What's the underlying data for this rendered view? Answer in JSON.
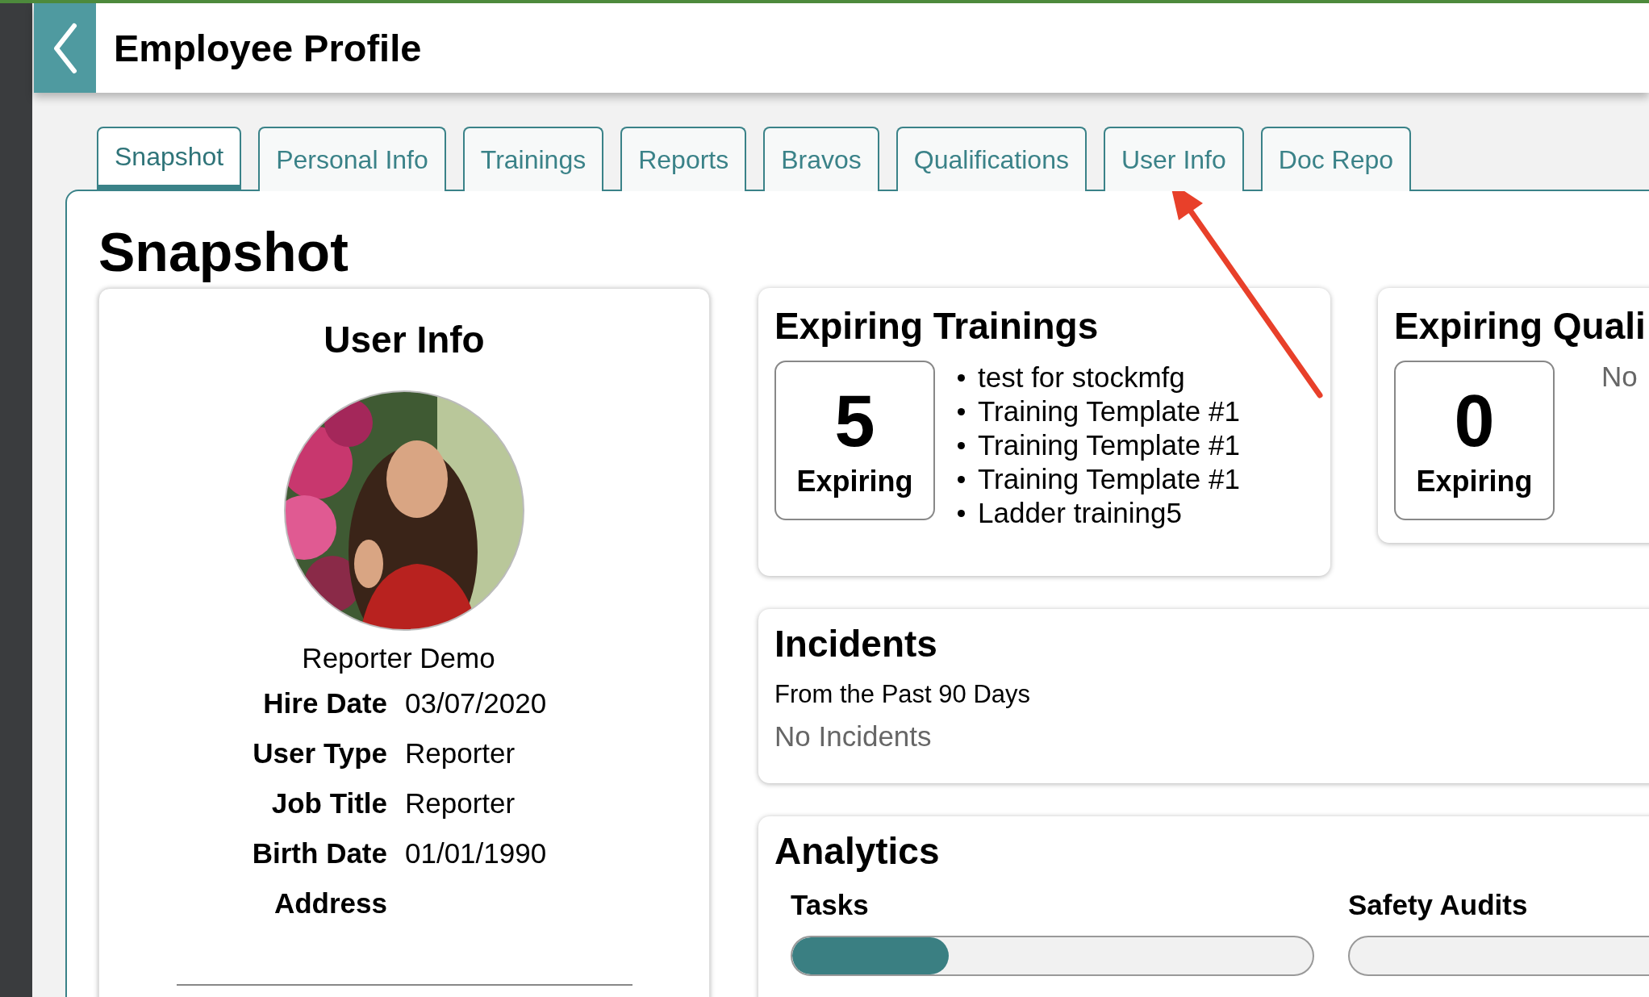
{
  "header": {
    "title": "Employee Profile"
  },
  "tabs": [
    {
      "label": "Snapshot",
      "selected": true
    },
    {
      "label": "Personal Info",
      "selected": false
    },
    {
      "label": "Trainings",
      "selected": false
    },
    {
      "label": "Reports",
      "selected": false
    },
    {
      "label": "Bravos",
      "selected": false
    },
    {
      "label": "Qualifications",
      "selected": false
    },
    {
      "label": "User Info",
      "selected": false
    },
    {
      "label": "Doc Repo",
      "selected": false
    }
  ],
  "page_title": "Snapshot",
  "user_info": {
    "title": "User Info",
    "name": "Reporter Demo",
    "fields": [
      {
        "label": "Hire Date",
        "value": "03/07/2020"
      },
      {
        "label": "User Type",
        "value": "Reporter"
      },
      {
        "label": "Job Title",
        "value": "Reporter"
      },
      {
        "label": "Birth Date",
        "value": "01/01/1990"
      },
      {
        "label": "Address"
      }
    ]
  },
  "expiring_trainings": {
    "title": "Expiring Trainings",
    "count": "5",
    "count_label": "Expiring",
    "items": [
      "test for stockmfg",
      "Training Template #1",
      "Training Template #1",
      "Training Template #1",
      "Ladder training5"
    ]
  },
  "expiring_qualifications": {
    "title": "Expiring Quali",
    "count": "0",
    "count_label": "Expiring",
    "message": "No"
  },
  "incidents": {
    "title": "Incidents",
    "subtitle": "From the Past 90 Days",
    "message": "No Incidents"
  },
  "analytics": {
    "title": "Analytics",
    "meters": [
      {
        "label": "Tasks",
        "level": 0.3
      },
      {
        "label": "Safety Audits"
      }
    ]
  }
}
